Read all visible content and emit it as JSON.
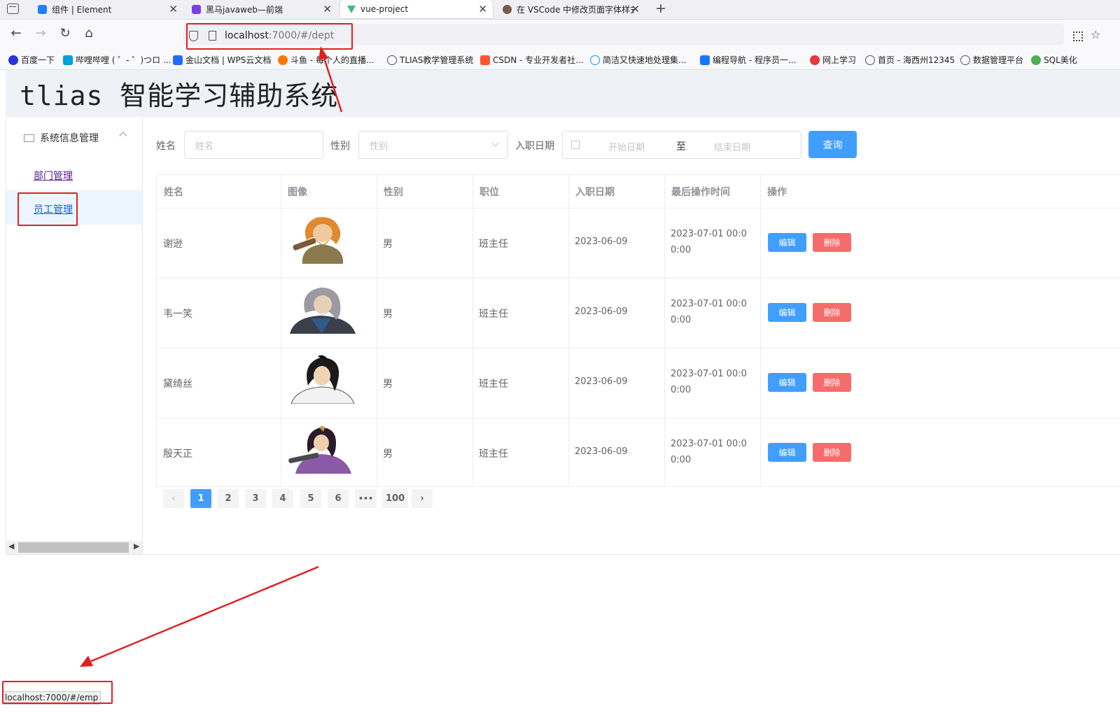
{
  "browser": {
    "tabs": [
      {
        "title": "组件 | Element",
        "color": "#1e80ff"
      },
      {
        "title": "黑马javaweb—前端",
        "color": "#7b3fe4"
      },
      {
        "title": "vue-project",
        "color": "#42b883"
      },
      {
        "title": "在 VSCode 中修改页面字体样式",
        "color": "#7a5a4a"
      }
    ],
    "url_host": "localhost",
    "url_rest": ":7000/#/dept",
    "bookmarks": [
      {
        "label": "百度一下",
        "color": "#2932e1"
      },
      {
        "label": "哔哩哔哩 ( ゜- ゜)つロ ...",
        "color": "#00a1d6"
      },
      {
        "label": "金山文档 | WPS云文档",
        "color": "#1f6cff"
      },
      {
        "label": "斗鱼 - 每个人的直播...",
        "color": "#ff7700"
      },
      {
        "label": "TLIAS教学管理系统",
        "color": "#666666"
      },
      {
        "label": "CSDN - 专业开发者社...",
        "color": "#fc5531"
      },
      {
        "label": "简洁又快速地处理集...",
        "color": "#1890ff"
      },
      {
        "label": "编程导航 - 程序员一...",
        "color": "#1677ff"
      },
      {
        "label": "网上学习",
        "color": "#e4393c"
      },
      {
        "label": "首页 - 海西州12345",
        "color": "#666666"
      },
      {
        "label": "数据管理平台",
        "color": "#666666"
      },
      {
        "label": "SQL美化",
        "color": "#4caf50"
      }
    ]
  },
  "app": {
    "title": "tlias 智能学习辅助系统",
    "menu": {
      "group": "系统信息管理",
      "items": [
        "部门管理",
        "员工管理"
      ]
    },
    "search": {
      "name_label": "姓名",
      "name_placeholder": "姓名",
      "gender_label": "性别",
      "gender_placeholder": "性别",
      "date_label": "入职日期",
      "start_placeholder": "开始日期",
      "date_separator": "至",
      "end_placeholder": "结束日期",
      "query_button": "查询"
    },
    "table": {
      "headers": [
        "姓名",
        "图像",
        "性别",
        "职位",
        "入职日期",
        "最后操作时间",
        "操作"
      ],
      "rows": [
        {
          "name": "谢逊",
          "gender": "男",
          "job": "班主任",
          "entry_date": "2023-06-09",
          "update_time_1": "2023-07-01 00:0",
          "update_time_2": "0:00",
          "avatar": "avatar-xie-xun"
        },
        {
          "name": "韦一笑",
          "gender": "男",
          "job": "班主任",
          "entry_date": "2023-06-09",
          "update_time_1": "2023-07-01 00:0",
          "update_time_2": "0:00",
          "avatar": "avatar-wei-yixiao"
        },
        {
          "name": "黛绮丝",
          "gender": "男",
          "job": "班主任",
          "entry_date": "2023-06-09",
          "update_time_1": "2023-07-01 00:0",
          "update_time_2": "0:00",
          "avatar": "avatar-dai-qisi"
        },
        {
          "name": "殷天正",
          "gender": "男",
          "job": "班主任",
          "entry_date": "2023-06-09",
          "update_time_1": "2023-07-01 00:0",
          "update_time_2": "0:00",
          "avatar": "avatar-yin-tianzheng"
        }
      ],
      "edit_label": "编辑",
      "delete_label": "删除"
    },
    "pagination": {
      "prev": "‹",
      "pages": [
        "1",
        "2",
        "3",
        "4",
        "5",
        "6",
        "•••",
        "100"
      ],
      "current": "1",
      "next": "›"
    }
  },
  "status_bar": {
    "link": "localhost:7000/#/emp"
  },
  "annotation_color": "#e02020"
}
